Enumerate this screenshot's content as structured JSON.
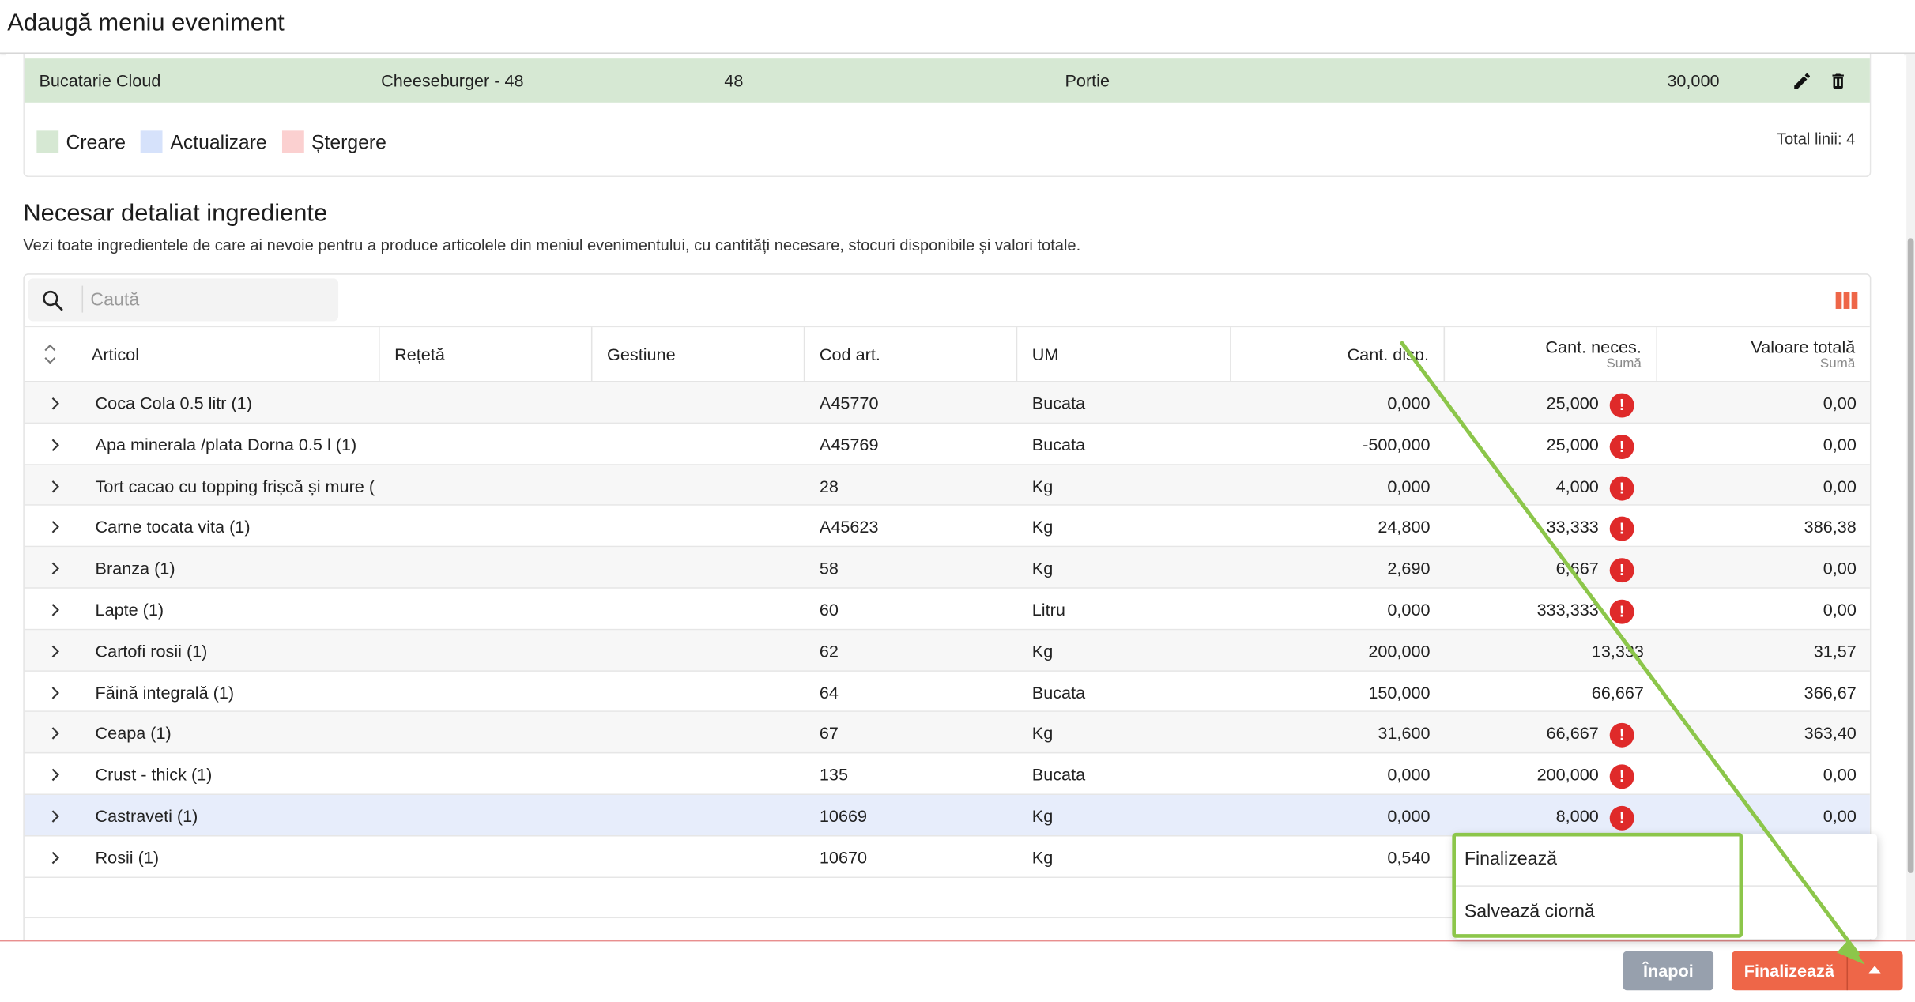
{
  "title": "Adaugă meniu eveniment",
  "top_row": {
    "location": "Bucatarie Cloud",
    "item": "Cheeseburger - 48",
    "qty": "48",
    "unit": "Portie",
    "value": "30,000"
  },
  "legend": [
    {
      "label": "Creare",
      "color": "#d6e8d3"
    },
    {
      "label": "Actualizare",
      "color": "#d6e2fb"
    },
    {
      "label": "Ștergere",
      "color": "#fbd0d0"
    }
  ],
  "total_lines": "Total linii: 4",
  "section": {
    "title": "Necesar detaliat ingrediente",
    "description": "Vezi toate ingredientele de care ai nevoie pentru a produce articolele din meniul evenimentului, cu cantități necesare, stocuri disponibile și valori totale."
  },
  "search": {
    "placeholder": "Caută"
  },
  "columns": {
    "articol": "Articol",
    "reteta": "Rețetă",
    "gestiune": "Gestiune",
    "cod": "Cod art.",
    "um": "UM",
    "cant_disp": "Cant. disp.",
    "cant_neces": "Cant. neces.",
    "cant_neces_sub": "Sumă",
    "valoare": "Valoare totală",
    "valoare_sub": "Sumă"
  },
  "rows": [
    {
      "articol": "Coca Cola 0.5 litr (1)",
      "cod": "A45770",
      "um": "Bucata",
      "disp": "0,000",
      "neces": "25,000",
      "alert": true,
      "valoare": "0,00"
    },
    {
      "articol": "Apa minerala /plata Dorna 0.5 l (1)",
      "cod": "A45769",
      "um": "Bucata",
      "disp": "-500,000",
      "neces": "25,000",
      "alert": true,
      "valoare": "0,00"
    },
    {
      "articol": "Tort cacao cu topping frișcă și mure (",
      "cod": "28",
      "um": "Kg",
      "disp": "0,000",
      "neces": "4,000",
      "alert": true,
      "valoare": "0,00"
    },
    {
      "articol": "Carne tocata vita (1)",
      "cod": "A45623",
      "um": "Kg",
      "disp": "24,800",
      "neces": "33,333",
      "alert": true,
      "valoare": "386,38"
    },
    {
      "articol": "Branza (1)",
      "cod": "58",
      "um": "Kg",
      "disp": "2,690",
      "neces": "6,667",
      "alert": true,
      "valoare": "0,00"
    },
    {
      "articol": "Lapte (1)",
      "cod": "60",
      "um": "Litru",
      "disp": "0,000",
      "neces": "333,333",
      "alert": true,
      "valoare": "0,00"
    },
    {
      "articol": "Cartofi rosii (1)",
      "cod": "62",
      "um": "Kg",
      "disp": "200,000",
      "neces": "13,333",
      "alert": false,
      "valoare": "31,57"
    },
    {
      "articol": "Făină integrală (1)",
      "cod": "64",
      "um": "Bucata",
      "disp": "150,000",
      "neces": "66,667",
      "alert": false,
      "valoare": "366,67"
    },
    {
      "articol": "Ceapa (1)",
      "cod": "67",
      "um": "Kg",
      "disp": "31,600",
      "neces": "66,667",
      "alert": true,
      "valoare": "363,40"
    },
    {
      "articol": "Crust - thick (1)",
      "cod": "135",
      "um": "Bucata",
      "disp": "0,000",
      "neces": "200,000",
      "alert": true,
      "valoare": "0,00"
    },
    {
      "articol": "Castraveti (1)",
      "cod": "10669",
      "um": "Kg",
      "disp": "0,000",
      "neces": "8,000",
      "alert": true,
      "valoare": "0,00",
      "selected": true
    },
    {
      "articol": "Rosii (1)",
      "cod": "10670",
      "um": "Kg",
      "disp": "0,540",
      "neces": "",
      "alert": false,
      "valoare": ""
    }
  ],
  "footer": {
    "back": "Înapoi",
    "finalize": "Finalizează"
  },
  "menu": {
    "finalize": "Finalizează",
    "save_draft": "Salvează ciornă"
  },
  "colors": {
    "accent": "#ee6648",
    "back_button": "#97a0ad",
    "alert": "#df2a2a",
    "annotation": "#8cc64a"
  }
}
